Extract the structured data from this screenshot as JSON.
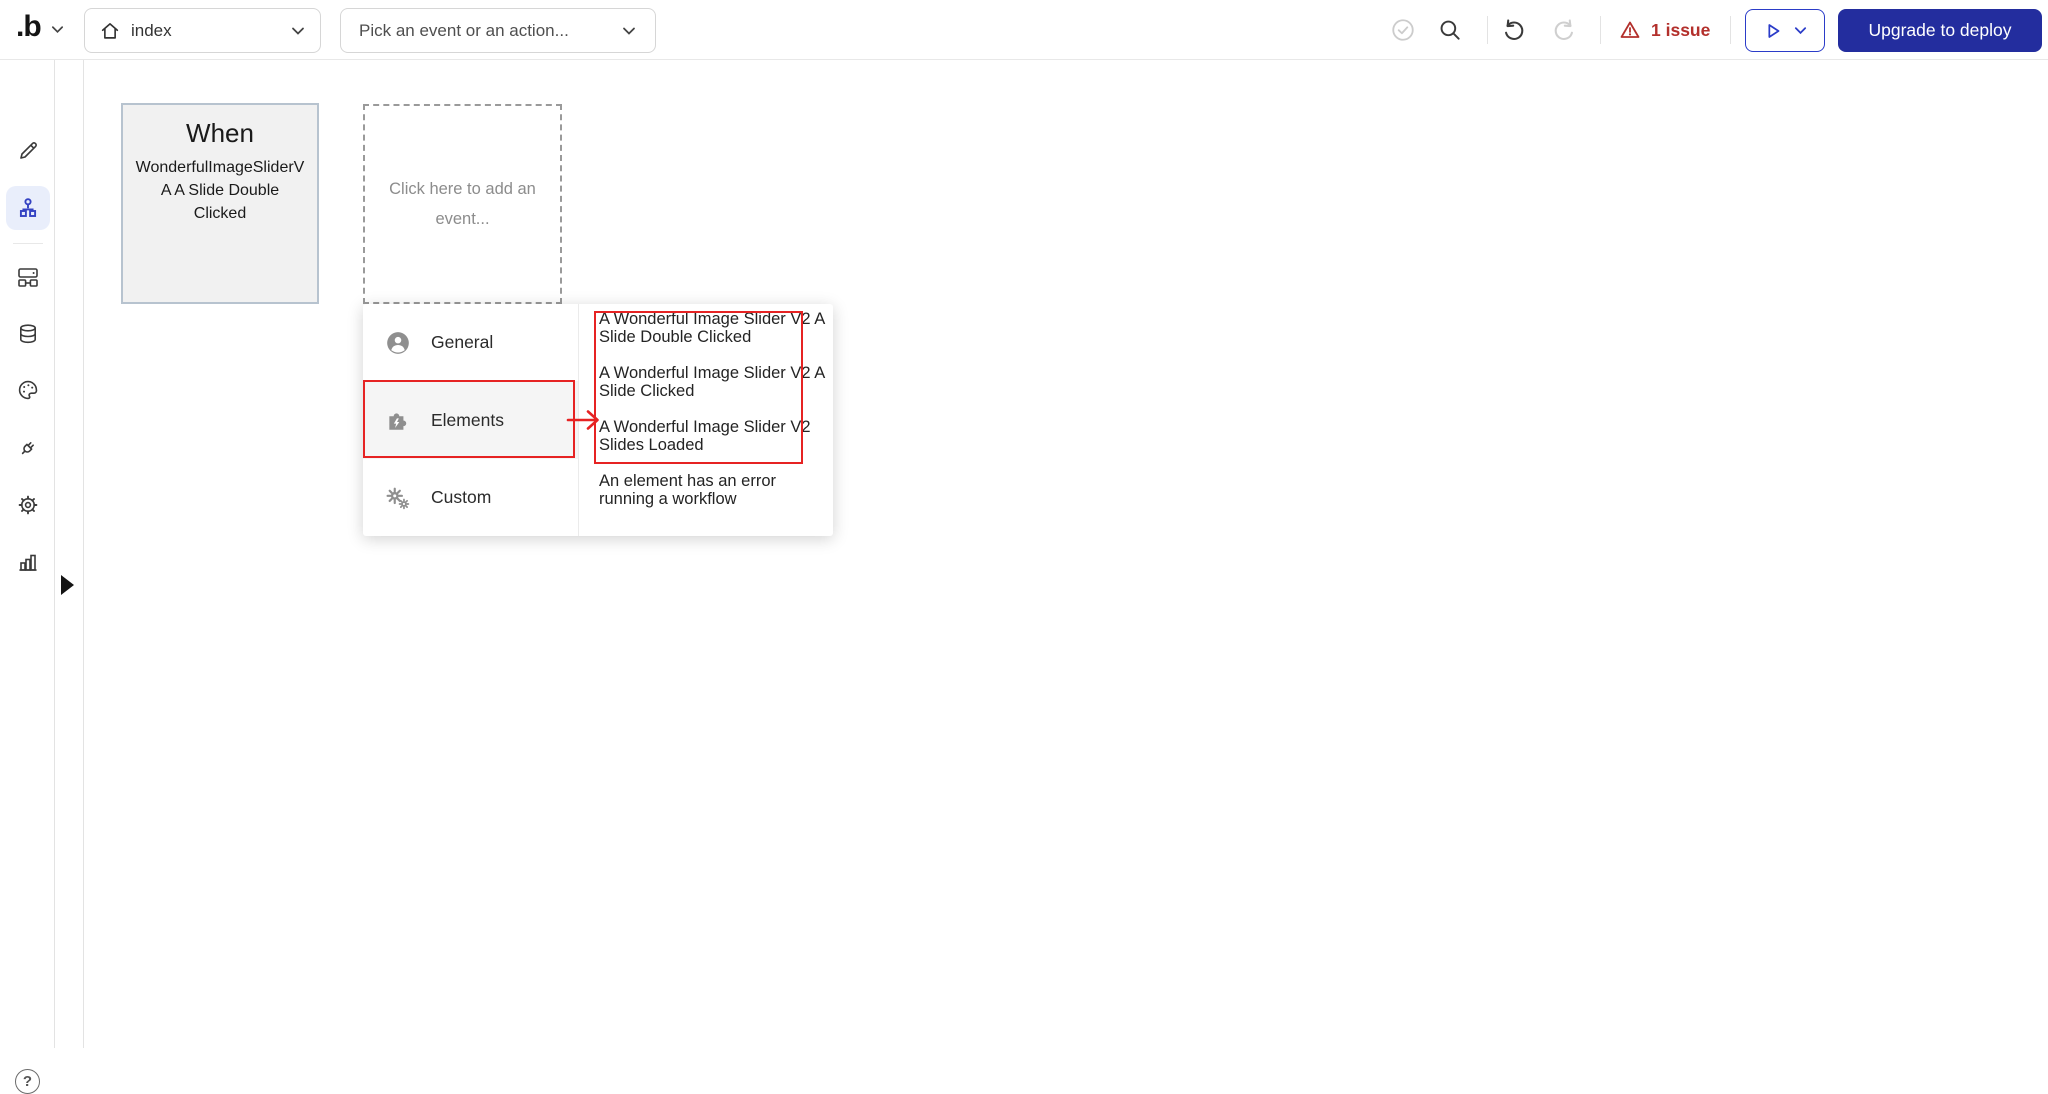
{
  "topbar": {
    "logo_text": ".b",
    "page_dropdown": {
      "value": "index"
    },
    "event_dropdown": {
      "placeholder": "Pick an event or an action..."
    },
    "issue_indicator": {
      "label": "1 issue",
      "color": "#b3302c"
    },
    "deploy_button": {
      "label": "Upgrade to deploy",
      "background": "#232d9e"
    }
  },
  "sidebar": {
    "items": [
      {
        "icon": "pencil-icon",
        "name": "design"
      },
      {
        "icon": "workflow-icon",
        "name": "workflow",
        "active": true
      },
      {
        "icon": "reusables-icon",
        "name": "reusables"
      },
      {
        "icon": "database-icon",
        "name": "data"
      },
      {
        "icon": "palette-icon",
        "name": "styles"
      },
      {
        "icon": "plug-icon",
        "name": "plugins"
      },
      {
        "icon": "gear-icon",
        "name": "settings"
      },
      {
        "icon": "bar-chart-icon",
        "name": "logs"
      }
    ],
    "active_color": "#3442c2",
    "active_background": "#e9eefb",
    "help_glyph": "?"
  },
  "canvas": {
    "event_card": {
      "title": "When",
      "description": "WonderfulImageSliderVA A Slide Double Clicked"
    },
    "add_event_placeholder": "Click here to add an event..."
  },
  "event_menu": {
    "categories": [
      {
        "label": "General",
        "icon": "person-icon"
      },
      {
        "label": "Elements",
        "icon": "puzzle-icon",
        "highlighted": true
      },
      {
        "label": "Custom",
        "icon": "gears-icon"
      }
    ],
    "element_events": [
      "A Wonderful Image Slider V2 A Slide Double Clicked",
      "A Wonderful Image Slider V2 A Slide Clicked",
      "A Wonderful Image Slider V2 Slides Loaded",
      "An element has an error running a workflow"
    ],
    "annotation_color": "#e62323"
  }
}
